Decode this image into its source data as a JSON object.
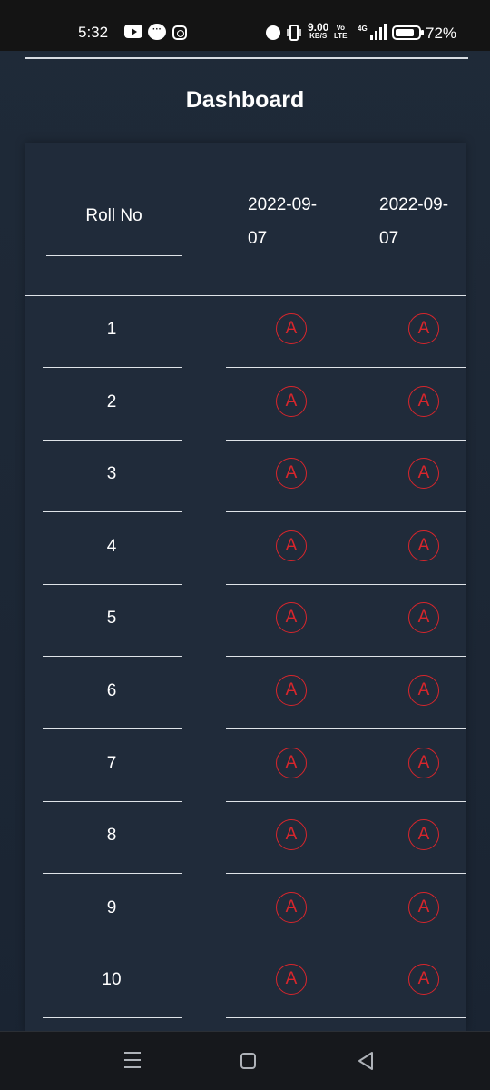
{
  "status_bar": {
    "time": "5:32",
    "net_speed": "9.00",
    "net_unit": "KB/S",
    "volte_top": "Vo",
    "volte_bottom": "LTE",
    "network": "4G",
    "battery": "72%",
    "icons": [
      "youtube-icon",
      "chat-icon",
      "instagram-icon",
      "alarm-icon",
      "vibrate-icon",
      "signal-icon",
      "battery-icon"
    ]
  },
  "page": {
    "title": "Dashboard"
  },
  "table": {
    "headers": {
      "roll": "Roll No",
      "date1": "2022-09-07",
      "date2": "2022-09-07"
    },
    "header_lines": {
      "date1_line1": "2022-09-",
      "date1_line2": "07",
      "date2_line1": "2022-09-",
      "date2_line2": "07"
    },
    "rows": [
      {
        "roll": "1",
        "d1": "A",
        "d2": "A"
      },
      {
        "roll": "2",
        "d1": "A",
        "d2": "A"
      },
      {
        "roll": "3",
        "d1": "A",
        "d2": "A"
      },
      {
        "roll": "4",
        "d1": "A",
        "d2": "A"
      },
      {
        "roll": "5",
        "d1": "A",
        "d2": "A"
      },
      {
        "roll": "6",
        "d1": "A",
        "d2": "A"
      },
      {
        "roll": "7",
        "d1": "A",
        "d2": "A"
      },
      {
        "roll": "8",
        "d1": "A",
        "d2": "A"
      },
      {
        "roll": "9",
        "d1": "A",
        "d2": "A"
      },
      {
        "roll": "10",
        "d1": "A",
        "d2": "A"
      }
    ],
    "colors": {
      "absent": "#d8262c",
      "background": "#1f2a38",
      "text": "#ffffff"
    }
  },
  "nav_bar": {
    "icons": [
      "recent-apps-icon",
      "home-icon",
      "back-icon"
    ]
  }
}
